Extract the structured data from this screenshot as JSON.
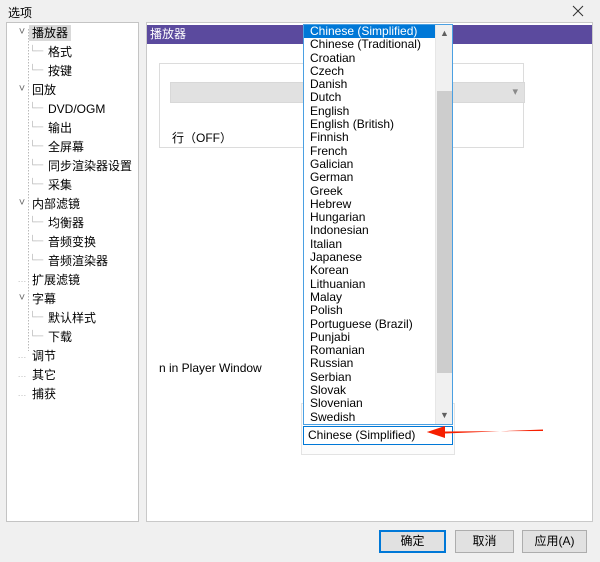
{
  "window": {
    "title": "选项",
    "close_icon": "close-icon"
  },
  "tree": {
    "items": [
      {
        "label": "播放器",
        "level": 0,
        "expander": "v",
        "selected": true
      },
      {
        "label": "格式",
        "level": 1,
        "expander": "",
        "selected": false
      },
      {
        "label": "按键",
        "level": 1,
        "expander": "",
        "selected": false
      },
      {
        "label": "回放",
        "level": 0,
        "expander": "v",
        "selected": false
      },
      {
        "label": "DVD/OGM",
        "level": 1,
        "expander": "",
        "selected": false
      },
      {
        "label": "输出",
        "level": 1,
        "expander": "",
        "selected": false
      },
      {
        "label": "全屏幕",
        "level": 1,
        "expander": "",
        "selected": false
      },
      {
        "label": "同步渲染器设置",
        "level": 1,
        "expander": "",
        "selected": false
      },
      {
        "label": "采集",
        "level": 1,
        "expander": "",
        "selected": false
      },
      {
        "label": "内部滤镜",
        "level": 0,
        "expander": "v",
        "selected": false
      },
      {
        "label": "均衡器",
        "level": 1,
        "expander": "",
        "selected": false
      },
      {
        "label": "音频变换",
        "level": 1,
        "expander": "",
        "selected": false
      },
      {
        "label": "音频渲染器",
        "level": 1,
        "expander": "",
        "selected": false
      },
      {
        "label": "扩展滤镜",
        "level": 0,
        "expander": "",
        "selected": false
      },
      {
        "label": "字幕",
        "level": 0,
        "expander": "v",
        "selected": false
      },
      {
        "label": "默认样式",
        "level": 1,
        "expander": "",
        "selected": false
      },
      {
        "label": "下载",
        "level": 1,
        "expander": "",
        "selected": false
      },
      {
        "label": "调节",
        "level": 0,
        "expander": "",
        "selected": false
      },
      {
        "label": "其它",
        "level": 0,
        "expander": "",
        "selected": false
      },
      {
        "label": "捕获",
        "level": 0,
        "expander": "",
        "selected": false
      }
    ]
  },
  "content": {
    "header_label": "播放器",
    "combo_arrow": "chevron-down-icon",
    "off_text": "行（OFF）",
    "player_window_text": "n in Player Window"
  },
  "language_combo": {
    "selected": "Chinese (Simplified)",
    "expanded": true,
    "options": [
      "Chinese (Simplified)",
      "Chinese (Traditional)",
      "Croatian",
      "Czech",
      "Danish",
      "Dutch",
      "English",
      "English (British)",
      "Finnish",
      "French",
      "Galician",
      "German",
      "Greek",
      "Hebrew",
      "Hungarian",
      "Indonesian",
      "Italian",
      "Japanese",
      "Korean",
      "Lithuanian",
      "Malay",
      "Polish",
      "Portuguese (Brazil)",
      "Punjabi",
      "Romanian",
      "Russian",
      "Serbian",
      "Slovak",
      "Slovenian",
      "Swedish"
    ],
    "scroll_up_icon": "chevron-up-icon",
    "scroll_down_icon": "chevron-down-icon"
  },
  "annotation": {
    "arrow_color": "#f61f00",
    "arrow_direction": "left"
  },
  "buttons": {
    "ok": "确定",
    "cancel": "取消",
    "apply": "应用(A)"
  },
  "colors": {
    "accent": "#0078d7",
    "header_purple": "#5b4a9e",
    "selection": "#0078d7",
    "arrow_red": "#f61f00"
  }
}
